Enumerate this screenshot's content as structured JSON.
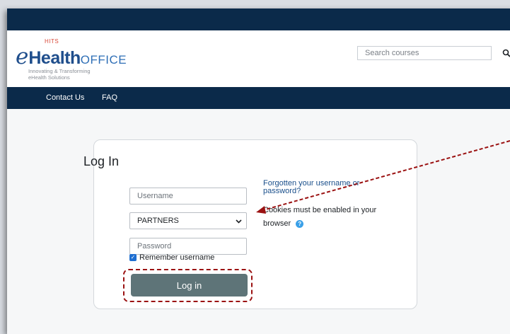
{
  "header": {
    "logo": {
      "small": "HITS",
      "e": "e",
      "health": "Health",
      "office": "OFFICE",
      "tagline1": "Innovating & Transforming",
      "tagline2": "eHealth Solutions"
    },
    "search": {
      "placeholder": "Search courses",
      "icon": "search-icon"
    }
  },
  "nav": {
    "items": [
      {
        "label": "Contact Us"
      },
      {
        "label": "FAQ"
      }
    ]
  },
  "login": {
    "title": "Log In",
    "username_placeholder": "Username",
    "organization_value": "PARTNERS",
    "password_placeholder": "Password",
    "remember_label": "Remember username",
    "remember_checked": true,
    "login_button": "Log in",
    "forgot_link": "Forgotten your username or password?",
    "cookies_text_1": "Cookies must be enabled in your",
    "cookies_text_2": "browser",
    "help_icon": "question-circle-icon"
  },
  "colors": {
    "navy": "#0b2a4a",
    "button": "#5e7478",
    "annotation_red": "#9b1212",
    "link": "#1a4f8b"
  }
}
